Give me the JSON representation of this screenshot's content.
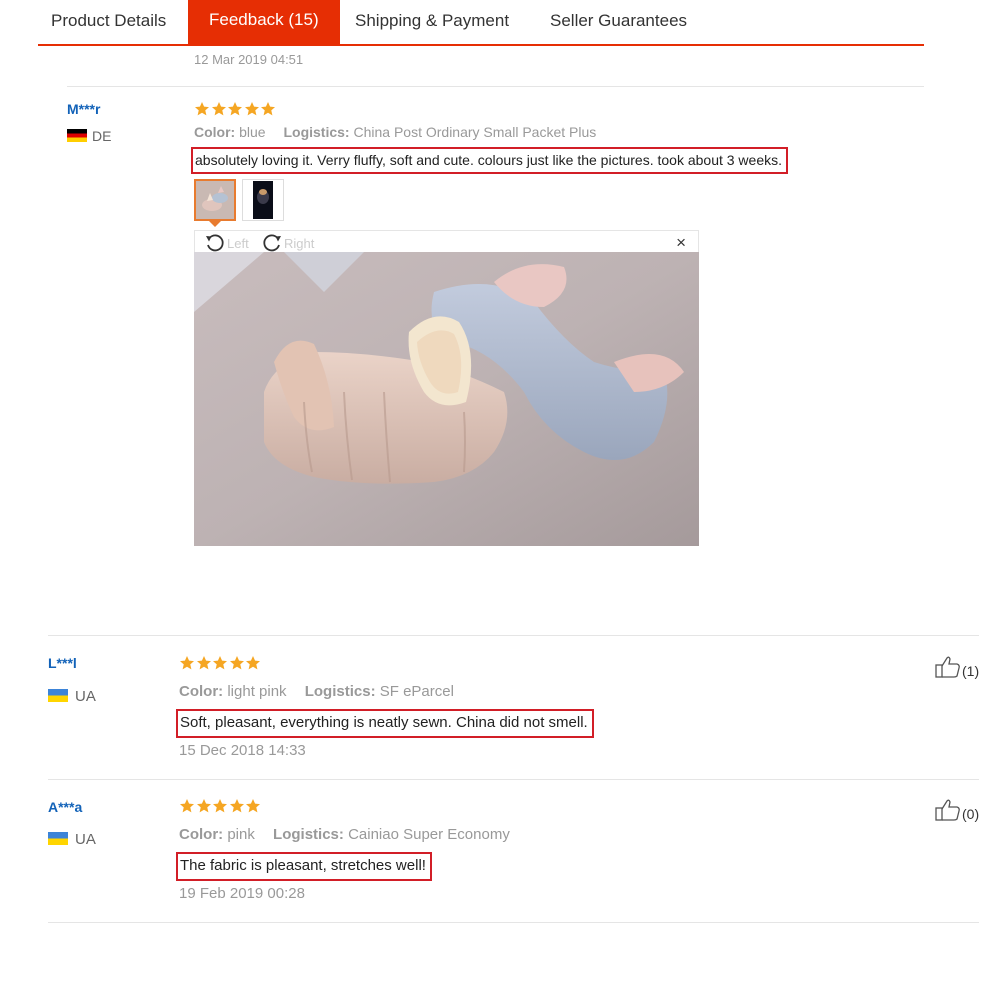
{
  "tabs": [
    {
      "label": "Product Details"
    },
    {
      "label": "Feedback (15)",
      "active": true
    },
    {
      "label": "Shipping & Payment"
    },
    {
      "label": "Seller Guarantees"
    }
  ],
  "top_date": "12 Mar 2019 04:51",
  "viewer": {
    "left_label": "Left",
    "right_label": "Right",
    "close": "×"
  },
  "reviews": [
    {
      "user": "M***r",
      "country": "DE",
      "rating": 5,
      "color_key": "Color:",
      "color": "blue",
      "logistics_key": "Logistics:",
      "logistics": "China Post Ordinary Small Packet Plus",
      "text": "absolutely loving it. Verry fluffy, soft and cute. colours just like the pictures. took about 3 weeks."
    },
    {
      "user": "L***l",
      "country": "UA",
      "rating": 5,
      "color_key": "Color:",
      "color": "light pink",
      "logistics_key": "Logistics:",
      "logistics": "SF eParcel",
      "text": "Soft, pleasant, everything is neatly sewn. China did not smell.",
      "date": "15 Dec 2018 14:33",
      "likes": "(1)"
    },
    {
      "user": "A***a",
      "country": "UA",
      "rating": 5,
      "color_key": "Color:",
      "color": "pink",
      "logistics_key": "Logistics:",
      "logistics": "Cainiao Super Economy",
      "text": "The fabric is pleasant, stretches well!",
      "date": "19 Feb 2019 00:28",
      "likes": "(0)"
    }
  ],
  "colors": {
    "accent": "#e62e04",
    "star": "#f5a623",
    "username": "#1262b8",
    "highlight_box": "#d21e27"
  },
  "icons": [
    "star-icon",
    "flag-de-icon",
    "flag-ua-icon",
    "rotate-left-icon",
    "rotate-right-icon",
    "close-icon",
    "thumbs-up-icon"
  ]
}
